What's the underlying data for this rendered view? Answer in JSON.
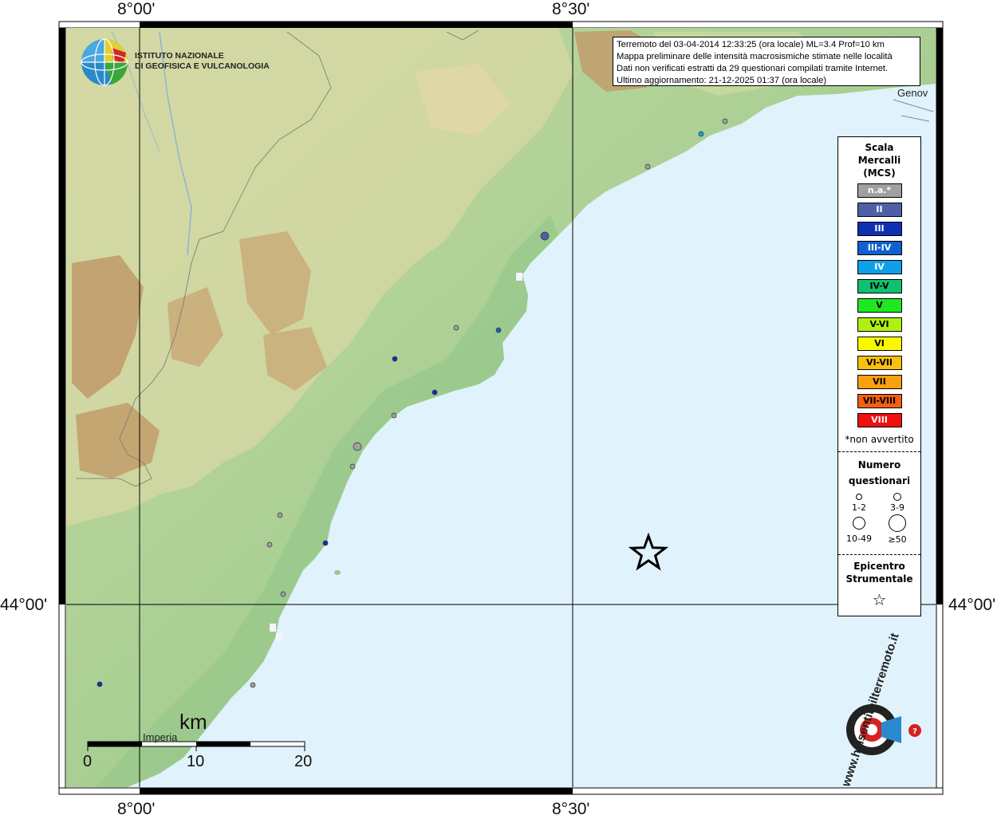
{
  "axes": {
    "top_ticks": [
      "8°00'",
      "8°30'"
    ],
    "bottom_ticks": [
      "8°00'",
      "8°30'"
    ],
    "left_tick": "44°00'",
    "right_tick": "44°00'"
  },
  "institute": {
    "line1": "ISTITUTO NAZIONALE",
    "line2": "DI GEOFISICA E VULCANOLOGIA"
  },
  "info_box": {
    "line1": "Terremoto del 03-04-2014 12:33:25 (ora locale) ML=3.4 Prof=10 km",
    "line2": "Mappa preliminare delle intensità macrosismiche stimate nelle località",
    "line3": "Dati non verificati estratti da 29 questionari compilati tramite Internet.",
    "line4": "Ultimo aggiornamento: 21-12-2025 01:37 (ora locale)"
  },
  "places": {
    "genova": "Genov",
    "imperia": "Imperia"
  },
  "legend": {
    "title": "Scala Mercalli (MCS)",
    "title_lines": [
      "Scala",
      "Mercalli",
      "(MCS)"
    ],
    "items": [
      {
        "label": "n.a.*",
        "color": "#a0a0a0",
        "text_color": "#ffffff"
      },
      {
        "label": "II",
        "color": "#5060a8",
        "text_color": "#ffffff"
      },
      {
        "label": "III",
        "color": "#1030b0",
        "text_color": "#ffffff"
      },
      {
        "label": "III-IV",
        "color": "#1060d0",
        "text_color": "#ffffff"
      },
      {
        "label": "IV",
        "color": "#10a0e8",
        "text_color": "#ffffff"
      },
      {
        "label": "IV-V",
        "color": "#10c070",
        "text_color": "#000000"
      },
      {
        "label": "V",
        "color": "#20e820",
        "text_color": "#000000"
      },
      {
        "label": "V-VI",
        "color": "#b0f010",
        "text_color": "#000000"
      },
      {
        "label": "VI",
        "color": "#f8f800",
        "text_color": "#000000"
      },
      {
        "label": "VI-VII",
        "color": "#f8c010",
        "text_color": "#000000"
      },
      {
        "label": "VII",
        "color": "#f8a010",
        "text_color": "#000000"
      },
      {
        "label": "VII-VIII",
        "color": "#f06010",
        "text_color": "#000000"
      },
      {
        "label": "VIII",
        "color": "#f01010",
        "text_color": "#ffffff"
      }
    ],
    "note": "*non avvertito",
    "questionnaires_title_1": "Numero",
    "questionnaires_title_2": "questionari",
    "q_labels": [
      "1-2",
      "3-9",
      "10-49",
      "≥50"
    ],
    "epicenter_title_1": "Epicentro",
    "epicenter_title_2": "Strumentale",
    "epicenter_symbol": "☆"
  },
  "scalebar": {
    "unit": "km",
    "labels": [
      "0",
      "10",
      "20"
    ]
  },
  "logo": {
    "text": "www.haisentitoilterremoto.it",
    "icon": "earthquake-logo-icon"
  },
  "map_colors": {
    "sea": "#e0f2fc",
    "lowland": "#a8cf98",
    "hills": "#d8d8a0",
    "mountains": "#b89060"
  }
}
